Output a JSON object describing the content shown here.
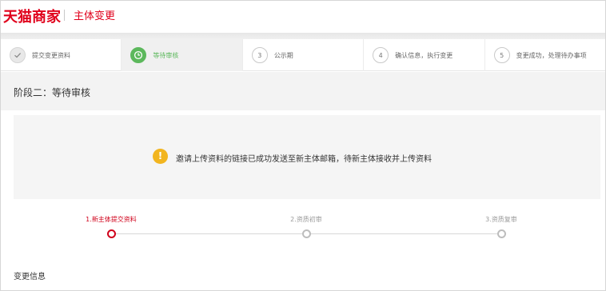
{
  "header": {
    "logo": "天猫商家",
    "title": "主体变更"
  },
  "steps": [
    {
      "number": "✓",
      "label": "提交变更资料",
      "state": "done",
      "icon": "check-icon"
    },
    {
      "number": "",
      "label": "等待审核",
      "state": "current",
      "icon": "clock-icon"
    },
    {
      "number": "3",
      "label": "公示期",
      "state": "pending"
    },
    {
      "number": "4",
      "label": "确认信息，执行变更",
      "state": "pending"
    },
    {
      "number": "5",
      "label": "变更成功，处理待办事项",
      "state": "pending"
    }
  ],
  "stage": {
    "title": "阶段二：等待审核"
  },
  "notice": {
    "icon": "warning-icon",
    "icon_glyph": "!",
    "text": "邀请上传资料的链接已成功发送至新主体邮箱，待新主体接收并上传资料"
  },
  "progress": {
    "nodes": [
      {
        "label": "1.新主体提交资料",
        "active": true
      },
      {
        "label": "2.资质初审",
        "active": false
      },
      {
        "label": "3.资质复审",
        "active": false
      }
    ]
  },
  "section": {
    "title": "变更信息"
  },
  "colors": {
    "brand": "#e0001b",
    "success": "#5cb85c",
    "warning": "#f2b51f",
    "progress_active": "#d0021b"
  }
}
